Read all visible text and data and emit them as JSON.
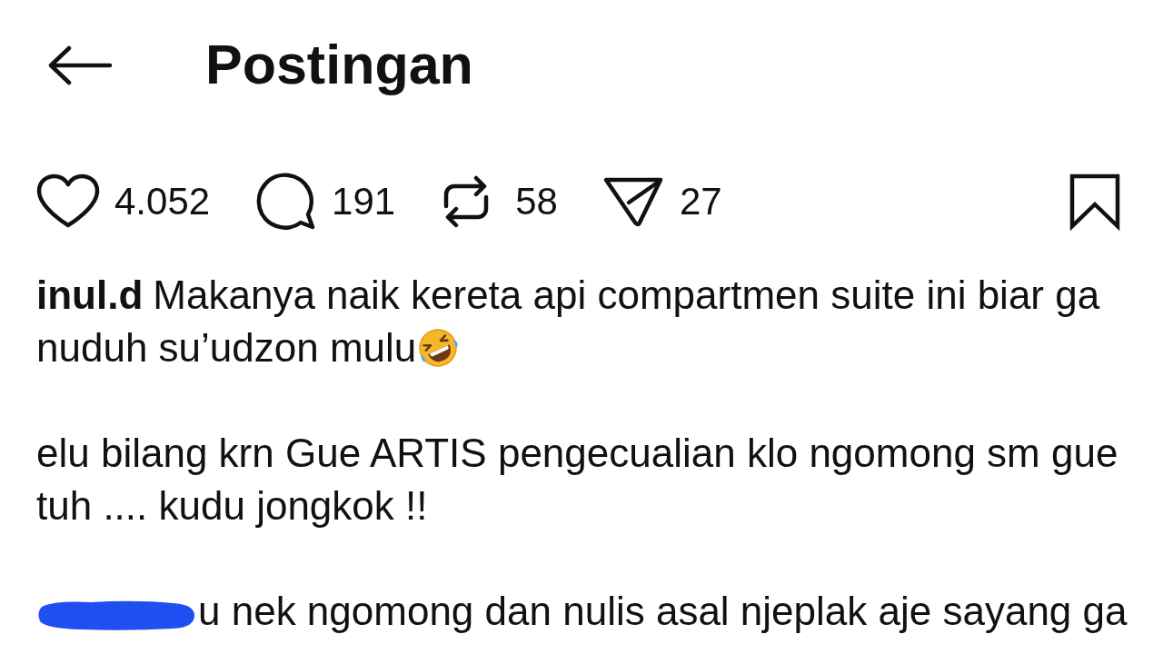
{
  "header": {
    "title": "Postingan"
  },
  "actions": [
    {
      "kind": "like",
      "count": "4.052"
    },
    {
      "kind": "comment",
      "count": "191"
    },
    {
      "kind": "repost",
      "count": "58"
    },
    {
      "kind": "share",
      "count": "27"
    }
  ],
  "bookmark": {
    "saved": false
  },
  "caption": {
    "username": "inul.d",
    "paragraphs": [
      {
        "redacted": false,
        "text": "Makanya naik kereta api compartmen suite ini biar ga nuduh su’udzon mulu",
        "emoji": true
      },
      {
        "redacted": false,
        "text": "elu bilang krn Gue ARTIS pengecualian klo ngomong sm gue tuh .... kudu jongkok !!",
        "emoji": false
      },
      {
        "redacted": true,
        "text": "u nek ngomong dan nulis asal njeplak aje sayang ga",
        "emoji": false
      }
    ]
  }
}
